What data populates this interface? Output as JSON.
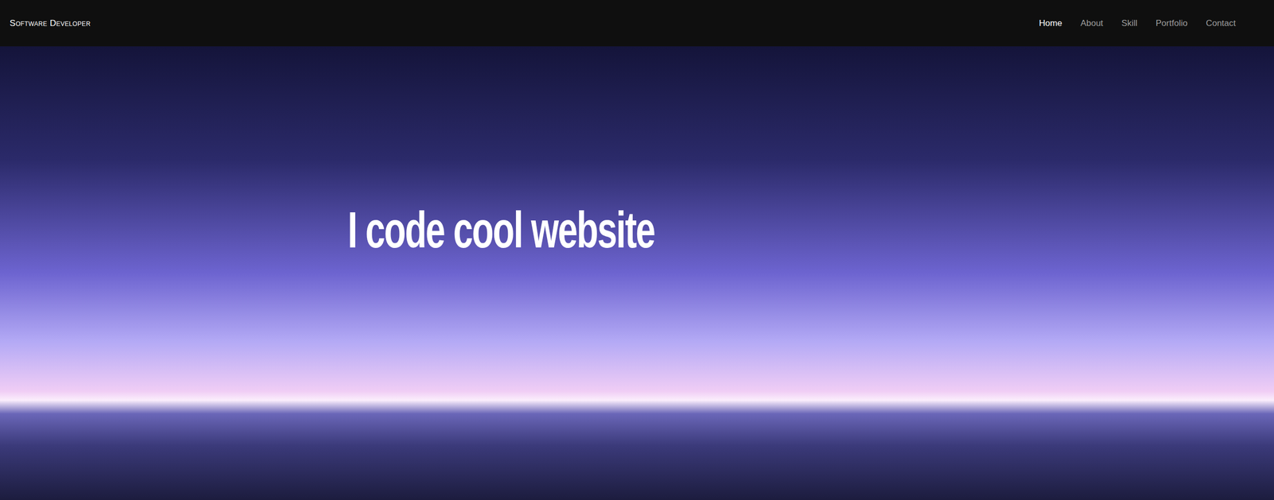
{
  "site": {
    "brand": "Software Developer"
  },
  "nav": [
    {
      "label": "Home",
      "selected": true
    },
    {
      "label": "About",
      "selected": false
    },
    {
      "label": "Skill",
      "selected": false
    },
    {
      "label": "Portfolio",
      "selected": false
    },
    {
      "label": "Contact",
      "selected": false
    }
  ],
  "hero": {
    "heading": "I code cool website"
  }
}
